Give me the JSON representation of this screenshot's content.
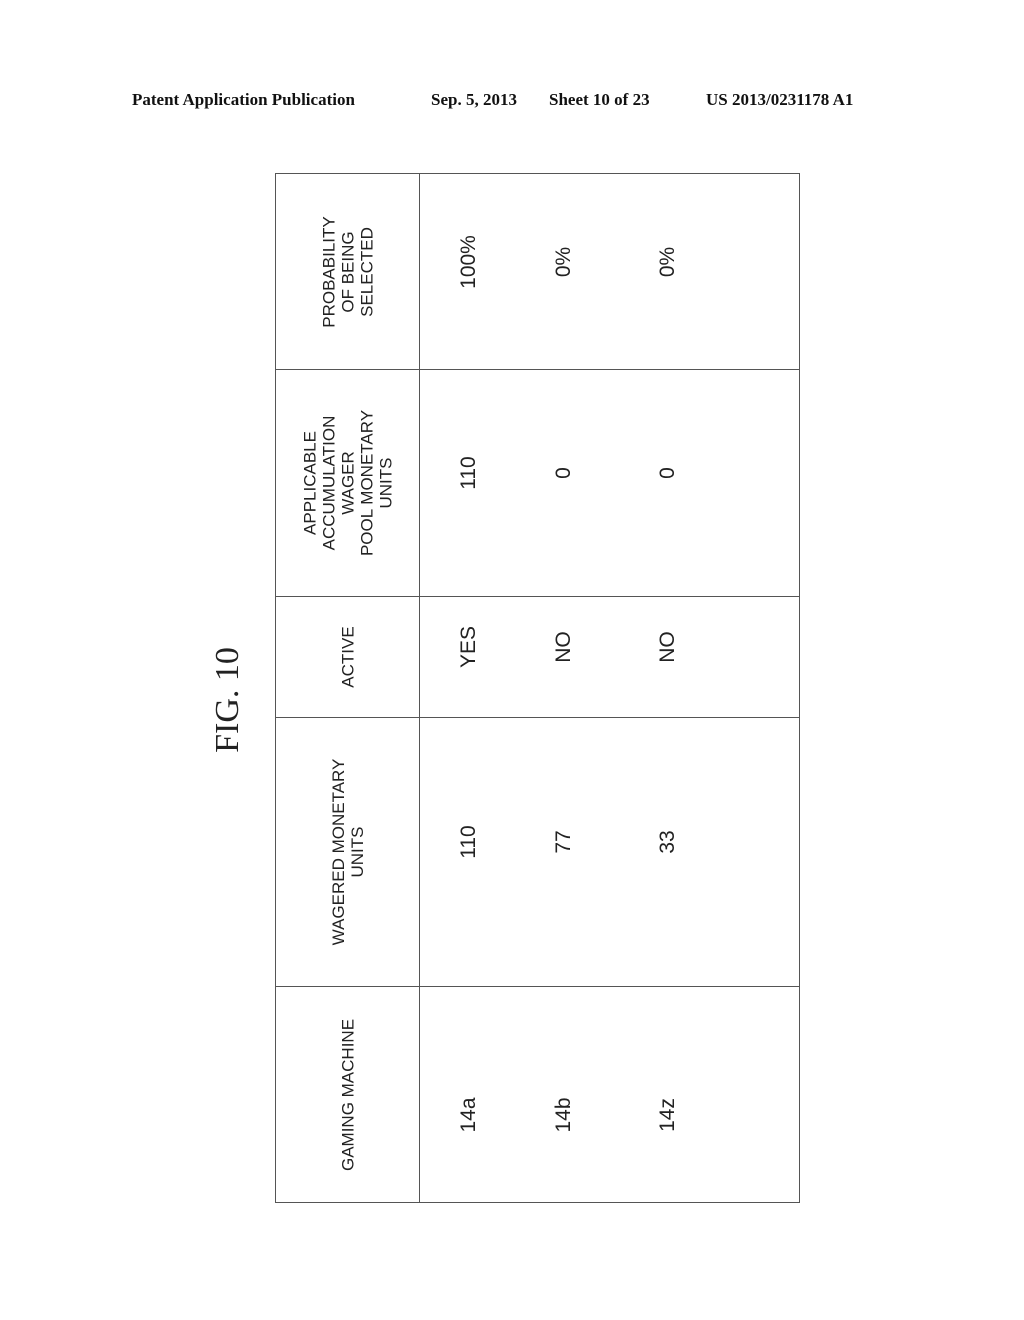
{
  "header": {
    "publication": "Patent Application Publication",
    "date": "Sep. 5, 2013",
    "sheet": "Sheet 10 of 23",
    "number": "US 2013/0231178 A1"
  },
  "figure": {
    "label": "FIG. 10"
  },
  "table": {
    "columns": [
      "GAMING MACHINE",
      "WAGERED MONETARY UNITS",
      "ACTIVE",
      "APPLICABLE ACCUMULATION WAGER POOL MONETARY UNITS",
      "PROBABILITY OF BEING SELECTED"
    ],
    "column_lines": [
      [
        "GAMING MACHINE"
      ],
      [
        "WAGERED MONETARY",
        "UNITS"
      ],
      [
        "ACTIVE"
      ],
      [
        "APPLICABLE",
        "ACCUMULATION",
        "WAGER",
        "POOL MONETARY",
        "UNITS"
      ],
      [
        "PROBABILITY",
        "OF BEING",
        "SELECTED"
      ]
    ],
    "rows": [
      [
        "14a",
        "110",
        "YES",
        "110",
        "100%"
      ],
      [
        "14b",
        "77",
        "NO",
        "0",
        "0%"
      ],
      [
        "14z",
        "33",
        "NO",
        "0",
        "0%"
      ]
    ]
  }
}
